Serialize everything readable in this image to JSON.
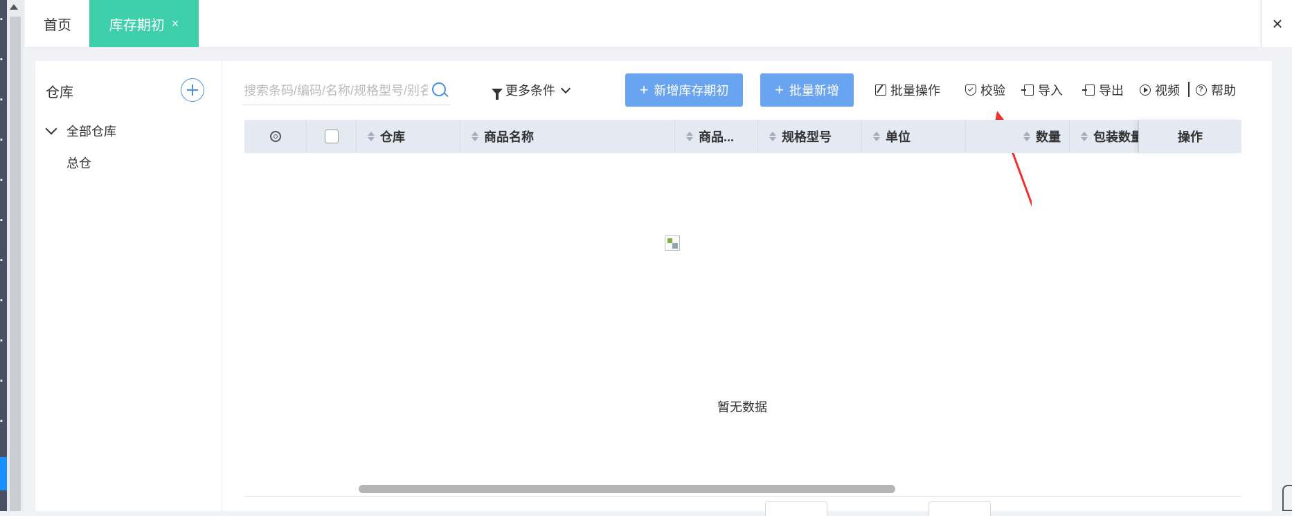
{
  "tabs": {
    "home": "首页",
    "active": "库存期初",
    "active_close": "×",
    "window_close": "×"
  },
  "sidebar": {
    "title": "仓库",
    "tree": {
      "all": "全部仓库",
      "items": [
        "总仓"
      ]
    }
  },
  "toolbar": {
    "search_placeholder": "搜索条码/编码/名称/规格型号/别名",
    "more_filters": "更多条件",
    "add_initial": "新增库存期初",
    "batch_add": "批量新增",
    "batch_ops": "批量操作",
    "verify": "校验",
    "import": "导入",
    "export": "导出",
    "video": "视频",
    "help": "帮助"
  },
  "table": {
    "columns": [
      "仓库",
      "商品名称",
      "商品...",
      "规格型号",
      "单位",
      "数量",
      "包装数量",
      "操作"
    ],
    "rows": [],
    "empty_text": "暂无数据"
  },
  "colors": {
    "active_tab": "#3ed0ab",
    "primary_button": "#69a4f0",
    "accent": "#4a90e2",
    "annotation_arrow": "#f0302e"
  }
}
